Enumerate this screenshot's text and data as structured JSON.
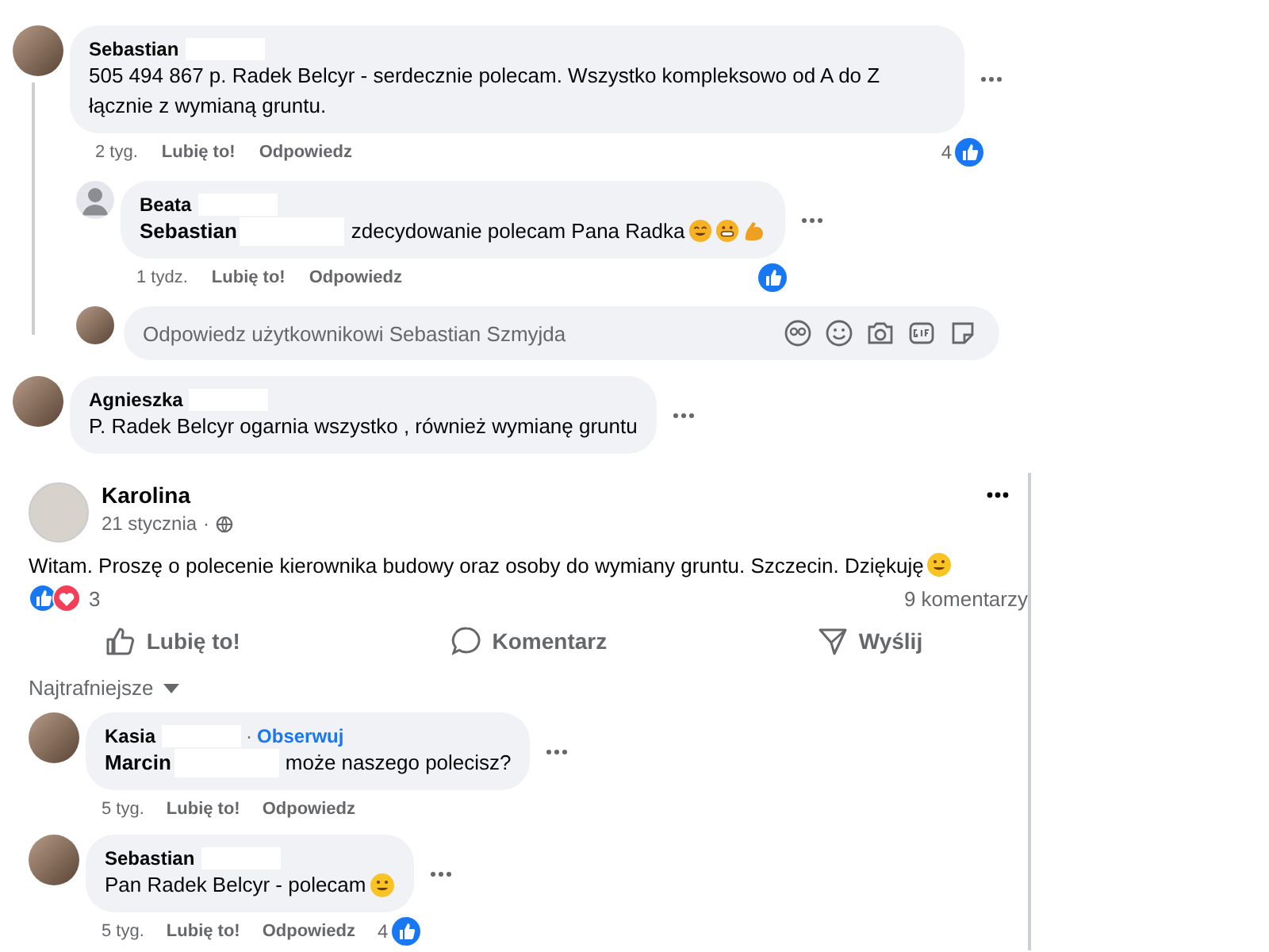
{
  "thread": [
    {
      "author": "Sebastian",
      "text": "505 494 867 p. Radek Belcyr - serdecznie polecam. Wszystko kompleksowo od A do Z łącznie z wymianą gruntu.",
      "time": "2 tyg.",
      "like": "Lubię to!",
      "reply": "Odpowiedz",
      "liked": true,
      "reaction_count": "4",
      "replies": [
        {
          "author": "Beata",
          "silhouette": true,
          "mention": "Sebastian",
          "text": "zdecydowanie polecam Pana Radka",
          "emoji": true,
          "extra_emojis": true,
          "time": "1 tydz.",
          "like": "Lubię to!",
          "reply": "Odpowiedz",
          "liked": true
        }
      ],
      "reply_box": {
        "placeholder": "Odpowiedz użytkownikowi Sebastian Szmyjda"
      }
    },
    {
      "author": "Agnieszka",
      "text": "P. Radek Belcyr ogarnia wszystko , również wymianę gruntu"
    }
  ],
  "post": {
    "author": "Karolina",
    "date": "21 stycznia",
    "separator": "·",
    "text": "Witam. Proszę o polecenie kierownika budowy oraz osoby do wymiany gruntu. Szczecin. Dziękuję",
    "emoji": true,
    "reaction_count": "3",
    "comment_count": "9 komentarzy",
    "actions": [
      {
        "kind": "like",
        "label": "Lubię to!"
      },
      {
        "kind": "comment",
        "label": "Komentarz"
      },
      {
        "kind": "share",
        "label": "Wyślij"
      }
    ],
    "sort": "Najtrafniejsze",
    "comments": [
      {
        "author": "Kasia",
        "separator": "·",
        "follow": "Obserwuj",
        "mention": "Marcin",
        "text": "może naszego polecisz?",
        "time": "5 tyg.",
        "like": "Lubię to!",
        "reply": "Odpowiedz",
        "liked": false
      },
      {
        "author": "Sebastian",
        "text": "Pan Radek Belcyr - polecam",
        "emoji": true,
        "time": "5 tyg.",
        "like": "Lubię to!",
        "reply": "Odpowiedz",
        "liked": true,
        "reaction_count": "4"
      }
    ]
  }
}
